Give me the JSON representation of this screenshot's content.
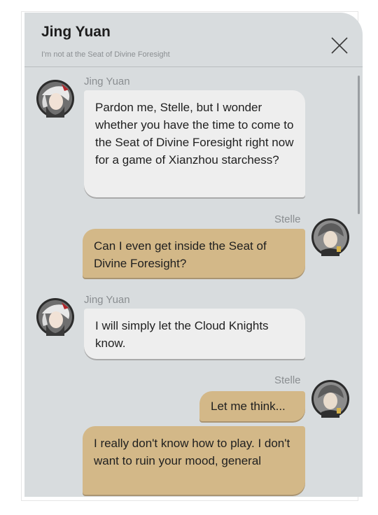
{
  "header": {
    "title": "Jing Yuan",
    "subtitle": "I'm not at the Seat of Divine Foresight"
  },
  "messages": [
    {
      "sender": "Jing Yuan",
      "text": "Pardon me, Stelle, but I wonder whether you have the time to come to the Seat of Divine Foresight right now for a game of Xianzhou starchess?"
    },
    {
      "sender": "Stelle",
      "text": "Can I even get inside the Seat of Divine Foresight?"
    },
    {
      "sender": "Jing Yuan",
      "text": "I will simply let the Cloud Knights know."
    },
    {
      "sender": "Stelle",
      "text": "Let me think..."
    },
    {
      "sender": "Stelle",
      "text": "I really don't know how to play. I don't want to ruin your mood, general"
    }
  ],
  "icons": {
    "close": "close-icon",
    "jing_yuan_avatar": "jing-yuan-avatar",
    "stelle_avatar": "stelle-avatar"
  },
  "colors": {
    "panel_bg": "#d8dcde",
    "incoming_bubble": "#eeeeee",
    "outgoing_bubble": "#d3b888"
  }
}
